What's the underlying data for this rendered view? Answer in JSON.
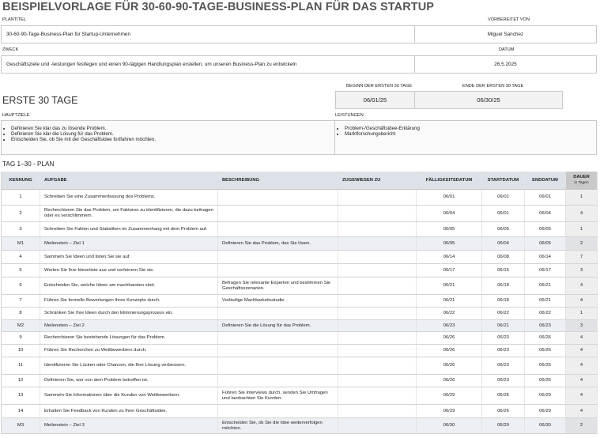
{
  "header": {
    "title": "BEISPIELVORLAGE FÜR 30-60-90-TAGE-BUSINESS-PLAN FÜR DAS STARTUP",
    "plan_title_label": "PLANTITEL",
    "plan_title_value": "30-60-90-Tage-Business-Plan für Startup-Unternehmen",
    "prepared_by_label": "VORBEREITET VON",
    "prepared_by_value": "Miguel Sanchez",
    "purpose_label": "ZWECK",
    "purpose_value": "Geschäftsziele und -leistungen festlegen und einen 90-tägigen Handlungsplan erstellen, um unseren Business-Plan zu entwickeln",
    "date_label": "DATUM",
    "date_value": "26.5.2025"
  },
  "phase": {
    "heading": "ERSTE 30 TAGE",
    "start_label": "BEGINN DER ERSTEN 30 TAGE",
    "start_value": "06/01/25",
    "end_label": "ENDE DER ERSTEN 30 TAGE",
    "end_value": "06/30/25",
    "goals_label": "HAUPTZIELE",
    "goals": [
      "Definieren Sie klar das zu lösende Problem.",
      "Definieren Sie klar die Lösung für das Problem.",
      "Entscheiden Sie, ob Sie mit der Geschäftsidee fortfahren möchten."
    ],
    "deliverables_label": "LEISTUNGEN",
    "deliverables": [
      "Problem-/Geschäftsidee-Erklärung",
      "Marktforschungsbericht"
    ]
  },
  "plan": {
    "title": "TAG 1–30 - PLAN",
    "headers": {
      "id": "KENNUNG",
      "task": "AUFGABE",
      "description": "BESCHREIBUNG",
      "assigned": "ZUGEWIESEN ZU",
      "due": "FÄLLIGKEITSDATUM",
      "start": "STARTDATUM",
      "end": "ENDDATUM",
      "duration": "DAUER",
      "duration_unit": "in Tagen"
    },
    "rows": [
      {
        "id": "1",
        "task": "Schreiben Sie eine Zusammenfassung des Problems.",
        "description": "",
        "assigned": "",
        "due": "06/01",
        "start": "06/01",
        "end": "06/01",
        "duration": "1",
        "milestone": false,
        "h": 20
      },
      {
        "id": "2",
        "task": "Recherchieren Sie das Problem, um Faktoren zu identifizieren, die dazu beitragen oder es verschlimmern.",
        "description": "",
        "assigned": "",
        "due": "06/04",
        "start": "06/01",
        "end": "06/04",
        "duration": "4",
        "milestone": false,
        "h": 21
      },
      {
        "id": "3",
        "task": "Schreiben Sie Fakten und Statistiken im Zusammenhang mit dem Problem auf.",
        "description": "",
        "assigned": "",
        "due": "06/05",
        "start": "06/05",
        "end": "06/05",
        "duration": "1",
        "milestone": false,
        "h": 19
      },
      {
        "id": "M1",
        "task": "Meilenstein – Ziel 1",
        "description": "Definieren Sie das Problem, das Sie lösen.",
        "assigned": "",
        "due": "06/05",
        "start": "06/04",
        "end": "06/05",
        "duration": "2",
        "milestone": true,
        "h": 17
      },
      {
        "id": "4",
        "task": "Sammeln Sie Ideen und listen Sie sie auf.",
        "description": "",
        "assigned": "",
        "due": "06/14",
        "start": "06/08",
        "end": "06/14",
        "duration": "7",
        "milestone": false,
        "h": 17
      },
      {
        "id": "5",
        "task": "Werten Sie Ihre Ideenliste aus und verfeinern Sie sie.",
        "description": "",
        "assigned": "",
        "due": "06/17",
        "start": "06/15",
        "end": "06/17",
        "duration": "3",
        "milestone": false,
        "h": 17
      },
      {
        "id": "6",
        "task": "Entscheiden Sie, welche Ideen am machbarsten sind.",
        "description": "Befragen Sie relevante Experten und bestimmen Sie Geschäftsszenarien.",
        "assigned": "",
        "due": "06/21",
        "start": "06/18",
        "end": "06/21",
        "duration": "4",
        "milestone": false,
        "h": 22
      },
      {
        "id": "7",
        "task": "Führen Sie formelle Bewertungen Ihres Konzepts durch.",
        "description": "Vorläufige Machbarkeitsstudie",
        "assigned": "",
        "due": "06/21",
        "start": "06/18",
        "end": "06/21",
        "duration": "4",
        "milestone": false,
        "h": 16
      },
      {
        "id": "8",
        "task": "Schränken Sie Ihre Ideen durch den Eliminierungsprozess ein.",
        "description": "",
        "assigned": "",
        "due": "06/22",
        "start": "06/22",
        "end": "06/22",
        "duration": "1",
        "milestone": false,
        "h": 16
      },
      {
        "id": "M2",
        "task": "Meilenstein – Ziel 2",
        "description": "Definieren Sie die Lösung für das Problem.",
        "assigned": "",
        "due": "06/23",
        "start": "06/21",
        "end": "06/23",
        "duration": "3",
        "milestone": true,
        "h": 15
      },
      {
        "id": "9",
        "task": "Recherchieren Sie bestehende Lösungen für das Problem.",
        "description": "",
        "assigned": "",
        "due": "06/26",
        "start": "06/23",
        "end": "06/26",
        "duration": "4",
        "milestone": false,
        "h": 16
      },
      {
        "id": "10",
        "task": "Führen Sie Recherchen zu Wettbewerbern durch.",
        "description": "",
        "assigned": "",
        "due": "06/26",
        "start": "06/23",
        "end": "06/26",
        "duration": "4",
        "milestone": false,
        "h": 16
      },
      {
        "id": "11",
        "task": "Identifizieren Sie Lücken oder Chancen, die Ihre Lösung verbessern.",
        "description": "",
        "assigned": "",
        "due": "06/26",
        "start": "06/23",
        "end": "06/26",
        "duration": "4",
        "milestone": false,
        "h": 22
      },
      {
        "id": "12",
        "task": "Definieren Sie, wer von dem Problem betroffen ist.",
        "description": "",
        "assigned": "",
        "due": "06/26",
        "start": "06/23",
        "end": "06/26",
        "duration": "4",
        "milestone": false,
        "h": 16
      },
      {
        "id": "13",
        "task": "Sammeln Sie Informationen über die Kunden von Wettbewerbern.",
        "description": "Führen Sie Interviews durch, senden Sie Umfragen und beobachten Sie Kunden.",
        "assigned": "",
        "due": "06/29",
        "start": "06/26",
        "end": "06/29",
        "duration": "4",
        "milestone": false,
        "h": 22
      },
      {
        "id": "14",
        "task": "Erhalten Sie Feedback von Kunden zu Ihrer Geschäftsidee.",
        "description": "",
        "assigned": "",
        "due": "06/29",
        "start": "06/26",
        "end": "06/29",
        "duration": "4",
        "milestone": false,
        "h": 17
      },
      {
        "id": "M3",
        "task": "Meilenstein – Ziel 3",
        "description": "Entscheiden Sie, ob Sie die Idee weiterverfolgen möchten.",
        "assigned": "",
        "due": "06/30",
        "start": "06/29",
        "end": "06/30",
        "duration": "2",
        "milestone": true,
        "h": 20
      }
    ]
  }
}
